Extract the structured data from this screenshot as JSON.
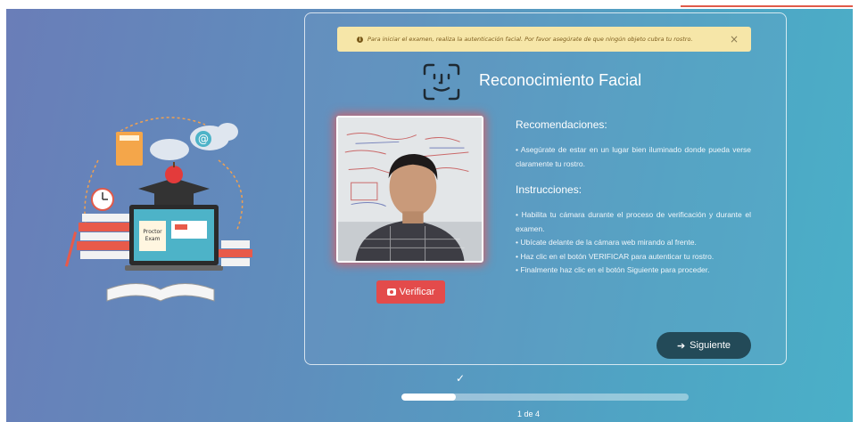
{
  "alert": {
    "message": "Para iniciar el examen, realiza la autenticación facial. Por favor asegúrate de que ningún objeto cubra tu rostro.",
    "close_symbol": "×",
    "icon": "info-icon"
  },
  "header": {
    "title": "Reconocimiento Facial",
    "icon": "face-id-icon"
  },
  "illustration": {
    "laptop_screen_text": "Proctor Exam",
    "cloud_symbol": "@"
  },
  "camera": {
    "verify_label": "Verificar",
    "verify_icon": "camera-icon"
  },
  "recommendations": {
    "heading": "Recomendaciones:",
    "text": "• Asegúrate de estar en un lugar bien iluminado donde pueda verse claramente tu rostro."
  },
  "instructions": {
    "heading": "Instrucciones:",
    "items": [
      "• Habilita tu cámara durante el proceso de verificación y durante el examen.",
      "• Ubícate delante de la cámara web mirando al frente.",
      "• Haz clic en el botón VERIFICAR para autenticar tu rostro.",
      "• Finalmente haz clic en el botón Siguiente para proceder."
    ]
  },
  "next_button": {
    "label": "Siguiente",
    "icon": "arrow-right-icon"
  },
  "progress": {
    "check_symbol": "✓",
    "step_label": "1 de 4",
    "fraction": 0.19
  },
  "colors": {
    "accent_red": "#e34b4b",
    "next_button": "#234a58",
    "alert_bg": "#f6e6a8"
  }
}
